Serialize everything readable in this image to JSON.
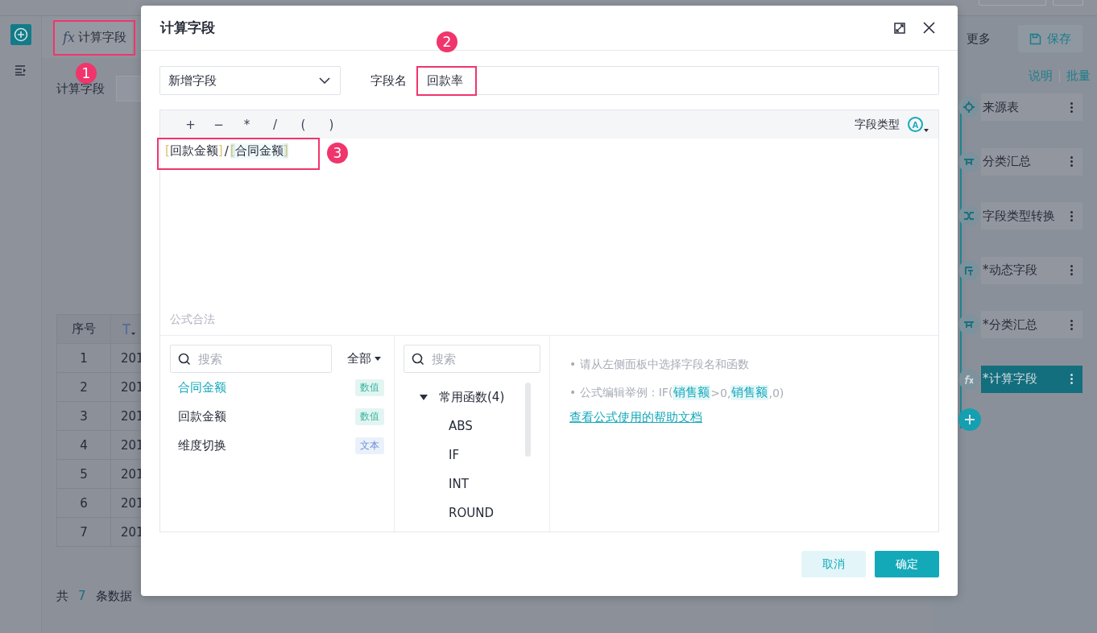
{
  "app": {
    "rail": [
      {
        "kind": "add",
        "selected": true
      },
      {
        "kind": "list",
        "selected": false
      }
    ],
    "tab": {
      "icon": "fx",
      "label": "计算字段"
    },
    "form_label": "计算字段",
    "table": {
      "columns": [
        "序号"
      ],
      "rows": [
        [
          "1",
          "201"
        ],
        [
          "2",
          "201"
        ],
        [
          "3",
          "201"
        ],
        [
          "4",
          "201"
        ],
        [
          "5",
          "201"
        ],
        [
          "6",
          "201"
        ],
        [
          "7",
          "201"
        ]
      ]
    },
    "footer": {
      "prefix": "共",
      "count": "7",
      "suffix": "条数据"
    },
    "right_panel": {
      "more": "更多",
      "save": "保存",
      "links": [
        "说明",
        "批量"
      ],
      "steps": [
        {
          "label": "来源表",
          "kind": "source",
          "selected": false
        },
        {
          "label": "分类汇总",
          "kind": "summary",
          "selected": false
        },
        {
          "label": "字段类型转换",
          "kind": "convert",
          "selected": false
        },
        {
          "label": "*动态字段",
          "kind": "dynamic",
          "selected": false
        },
        {
          "label": "*分类汇总",
          "kind": "summary",
          "selected": false
        },
        {
          "label": "*计算字段",
          "kind": "formula",
          "selected": true
        }
      ]
    }
  },
  "dialog": {
    "title": "计算字段",
    "mode": "新增字段",
    "name_label": "字段名",
    "name_value": "回款率",
    "operators": [
      "+",
      "−",
      "*",
      "/",
      "(",
      ")"
    ],
    "field_type_label": "字段类型",
    "field_type_icon": "A",
    "formula": [
      {
        "kind": "field",
        "open": "[",
        "text": "回款金额",
        "close": "]",
        "highlighted": false
      },
      {
        "kind": "op",
        "text": "/"
      },
      {
        "kind": "field",
        "open": "[",
        "text": "合同金额",
        "close": "]",
        "highlighted": true
      }
    ],
    "status": "公式合法",
    "fields_search": {
      "placeholder": "搜索"
    },
    "filter": "全部",
    "fields": [
      {
        "name": "合同金额",
        "type": "数值",
        "kind": "number",
        "selected": true
      },
      {
        "name": "回款金额",
        "type": "数值",
        "kind": "number",
        "selected": false
      },
      {
        "name": "维度切换",
        "type": "文本",
        "kind": "text",
        "selected": false
      }
    ],
    "functions_search": {
      "placeholder": "搜索"
    },
    "function_groups": [
      {
        "name": "常用函数(4)",
        "expanded": true,
        "children": [
          {
            "name": "ABS"
          },
          {
            "name": "IF"
          },
          {
            "name": "INT"
          },
          {
            "name": "ROUND"
          }
        ]
      }
    ],
    "help": {
      "hint": "• 请从左侧面板中选择字段名和函数",
      "example": [
        {
          "kind": "plain",
          "text": "• 公式编辑举例：IF("
        },
        {
          "kind": "field",
          "text": "销售额"
        },
        {
          "kind": "plain",
          "text": ">0,"
        },
        {
          "kind": "field",
          "text": "销售额"
        },
        {
          "kind": "plain",
          "text": ",0)"
        }
      ],
      "link": "查看公式使用的帮助文档"
    },
    "buttons": [
      {
        "label": "取消",
        "kind": "secondary"
      },
      {
        "label": "确定",
        "kind": "primary"
      }
    ]
  },
  "annotations": [
    {
      "label": "1"
    },
    {
      "label": "2"
    },
    {
      "label": "3"
    }
  ]
}
